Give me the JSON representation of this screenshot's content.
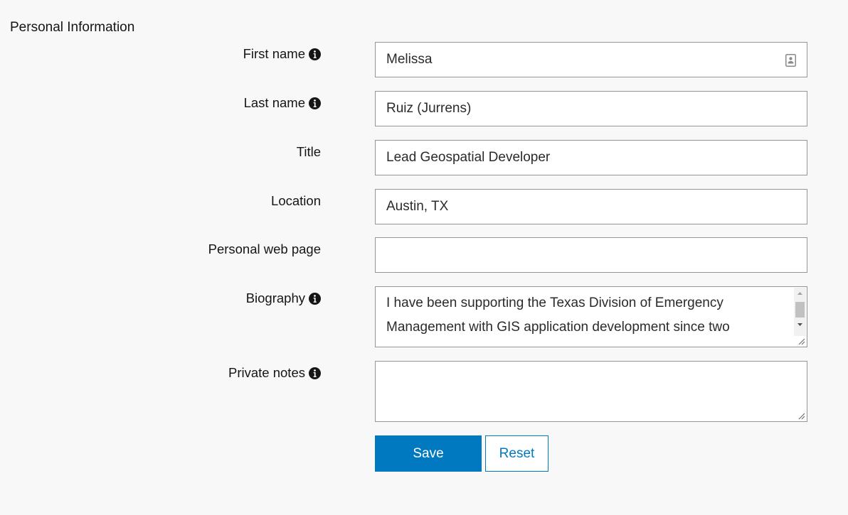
{
  "section": {
    "title": "Personal Information"
  },
  "fields": {
    "first_name": {
      "label": "First name",
      "value": "Melissa",
      "has_info": true
    },
    "last_name": {
      "label": "Last name",
      "value": "Ruiz (Jurrens)",
      "has_info": true
    },
    "title": {
      "label": "Title",
      "value": "Lead Geospatial Developer",
      "has_info": false
    },
    "location": {
      "label": "Location",
      "value": "Austin, TX",
      "has_info": false
    },
    "web_page": {
      "label": "Personal web page",
      "value": "",
      "has_info": false
    },
    "biography": {
      "label": "Biography",
      "value": "I have been supporting the Texas Division of Emergency\nManagement with GIS application development since two",
      "has_info": true
    },
    "private_notes": {
      "label": "Private notes",
      "value": "",
      "has_info": true
    }
  },
  "buttons": {
    "save": "Save",
    "reset": "Reset"
  },
  "colors": {
    "accent": "#0079c1",
    "background": "#f8f8f8",
    "field_border": "#959595"
  },
  "icons": {
    "info": "info-circle-icon",
    "contact_card": "contact-card-icon"
  }
}
